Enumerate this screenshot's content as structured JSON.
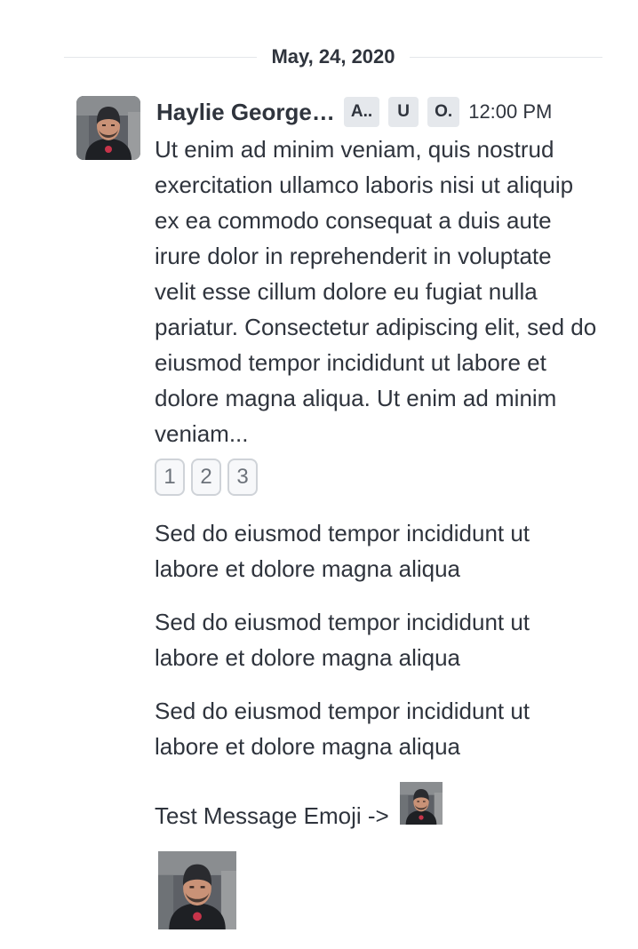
{
  "date_divider": {
    "label": "May, 24, 2020"
  },
  "message": {
    "author": "Haylie George…",
    "role_tags": [
      "A..",
      "U",
      "O."
    ],
    "time": "12:00 PM",
    "text": "Ut enim ad minim veniam, quis nostrud exercitation ullamco laboris nisi ut aliquip ex ea commodo consequat a duis aute irure dolor in reprehenderit in voluptate velit esse cillum dolore eu fugiat nulla pariatur. Consectetur adipiscing elit, sed do eiusmod tempor incididunt ut labore et dolore magna aliqua. Ut enim ad minim veniam...",
    "reactions": [
      "1",
      "2",
      "3"
    ],
    "avatar_icon": "user-avatar-photo"
  },
  "sequential_messages": [
    "Sed do eiusmod tempor incididunt ut labore et dolore magna aliqua",
    "Sed do eiusmod tempor incididunt ut labore et dolore magna aliqua",
    "Sed do eiusmod tempor incididunt ut labore et dolore magna aliqua"
  ],
  "emoji_message": {
    "text": "Test Message Emoji ->",
    "emoji_icon": "custom-emoji-photo"
  },
  "attachment": {
    "icon": "image-attachment-photo"
  },
  "colors": {
    "text": "#2f343d",
    "divider": "#e4e7ea",
    "tag_bg": "#e5e8ec",
    "reaction_border": "#cfd3d8"
  }
}
